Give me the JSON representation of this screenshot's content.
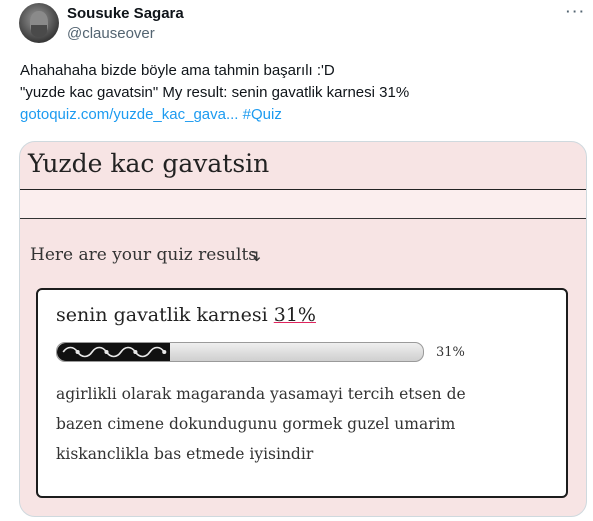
{
  "tweet": {
    "author_name": "Sousuke Sagara",
    "author_handle": "@clauseover",
    "more_icon": "⋅⋅⋅",
    "text_line1": "Ahahahaha bizde böyle ama tahmin başarılı :'D",
    "text_line2": "\"yuzde kac gavatsin\" My result: senin gavatlik karnesi 31%",
    "link_text": "gotoquiz.com/yuzde_kac_gava...",
    "hashtag": "#Quiz"
  },
  "quiz": {
    "title": "Yuzde kac gavatsin",
    "results_heading": "Here are your quiz results",
    "results_arrow": "↴",
    "result_title_prefix": "senin gavatlik karnesi ",
    "result_title_percent": "31%",
    "progress_value": 0.31,
    "progress_label": "31%",
    "description_line1": "agirlikli olarak magaranda yasamayi tercih etsen de",
    "description_line2": "bazen cimene dokundugunu gormek guzel umarim",
    "description_line3": "kiskanclikla bas etmede iyisindir"
  },
  "colors": {
    "link": "#1d9bf0",
    "media_bg": "#f7e4e4",
    "handle": "#536471"
  }
}
